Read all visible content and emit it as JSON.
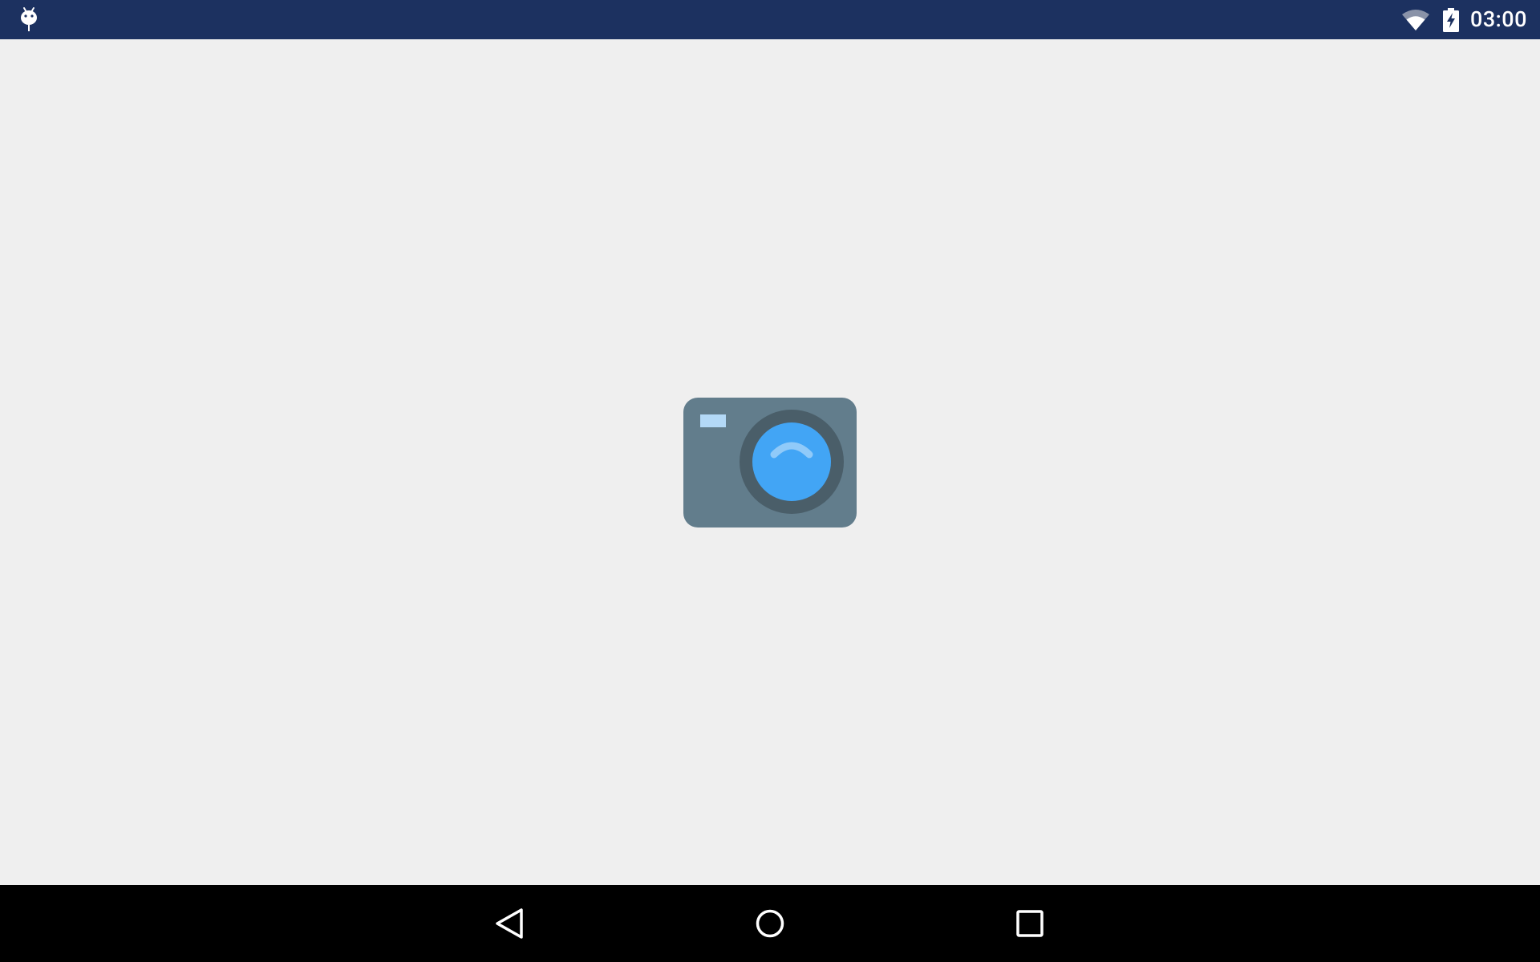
{
  "status_bar": {
    "time": "03:00",
    "left_icon": "android-debug-icon",
    "icons": [
      "wifi-icon",
      "battery-charging-icon"
    ],
    "background": "#1c3160"
  },
  "content": {
    "background": "#efefef",
    "center_icon": "camera-icon"
  },
  "nav_bar": {
    "buttons": [
      "back-icon",
      "home-icon",
      "recents-icon"
    ],
    "background": "#000000"
  }
}
